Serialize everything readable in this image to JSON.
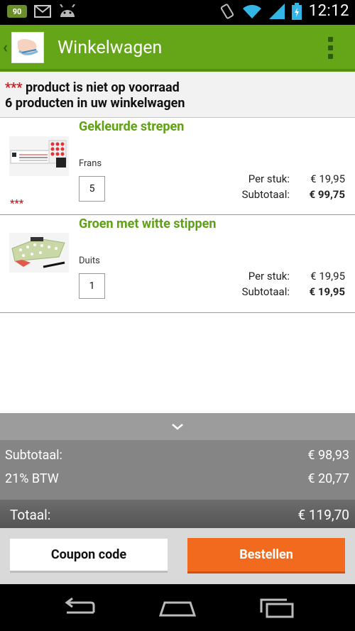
{
  "status_bar": {
    "battery_badge": "90",
    "time": "12:12",
    "icons": [
      "battery-badge-icon",
      "gmail-icon",
      "android-icon",
      "vibrate-icon",
      "wifi-icon",
      "signal-icon",
      "battery-icon"
    ]
  },
  "action_bar": {
    "title": "Winkelwagen",
    "icons": [
      "back-chevron-icon",
      "app-logo-icon",
      "overflow-menu-icon"
    ]
  },
  "banner": {
    "stars": "***",
    "stock_notice": " product is niet op voorraad",
    "count_text": "6 producten in uw winkelwagen"
  },
  "items": [
    {
      "title": "Gekleurde strepen",
      "variant": "Frans",
      "quantity": "5",
      "unit_label": "Per stuk:",
      "unit_price": "€ 19,95",
      "subtotal_label": "Subtotaal:",
      "subtotal": "€ 99,75",
      "out_of_stock_marker": "***"
    },
    {
      "title": "Groen met witte stippen",
      "variant": "Duits",
      "quantity": "1",
      "unit_label": "Per stuk:",
      "unit_price": "€ 19,95",
      "subtotal_label": "Subtotaal:",
      "subtotal": "€ 19,95",
      "out_of_stock_marker": ""
    }
  ],
  "totals": {
    "subtotal_label": "Subtotaal:",
    "subtotal": "€ 98,93",
    "vat_label": "21% BTW",
    "vat": "€ 20,77",
    "total_label": "Totaal:",
    "total": "€ 119,70"
  },
  "buttons": {
    "coupon": "Coupon code",
    "order": "Bestellen"
  },
  "colors": {
    "brand_green": "#64a618",
    "order_orange": "#f26a1d",
    "warning_red": "#d6161b"
  },
  "nav": [
    "back-icon",
    "home-icon",
    "recent-apps-icon"
  ]
}
